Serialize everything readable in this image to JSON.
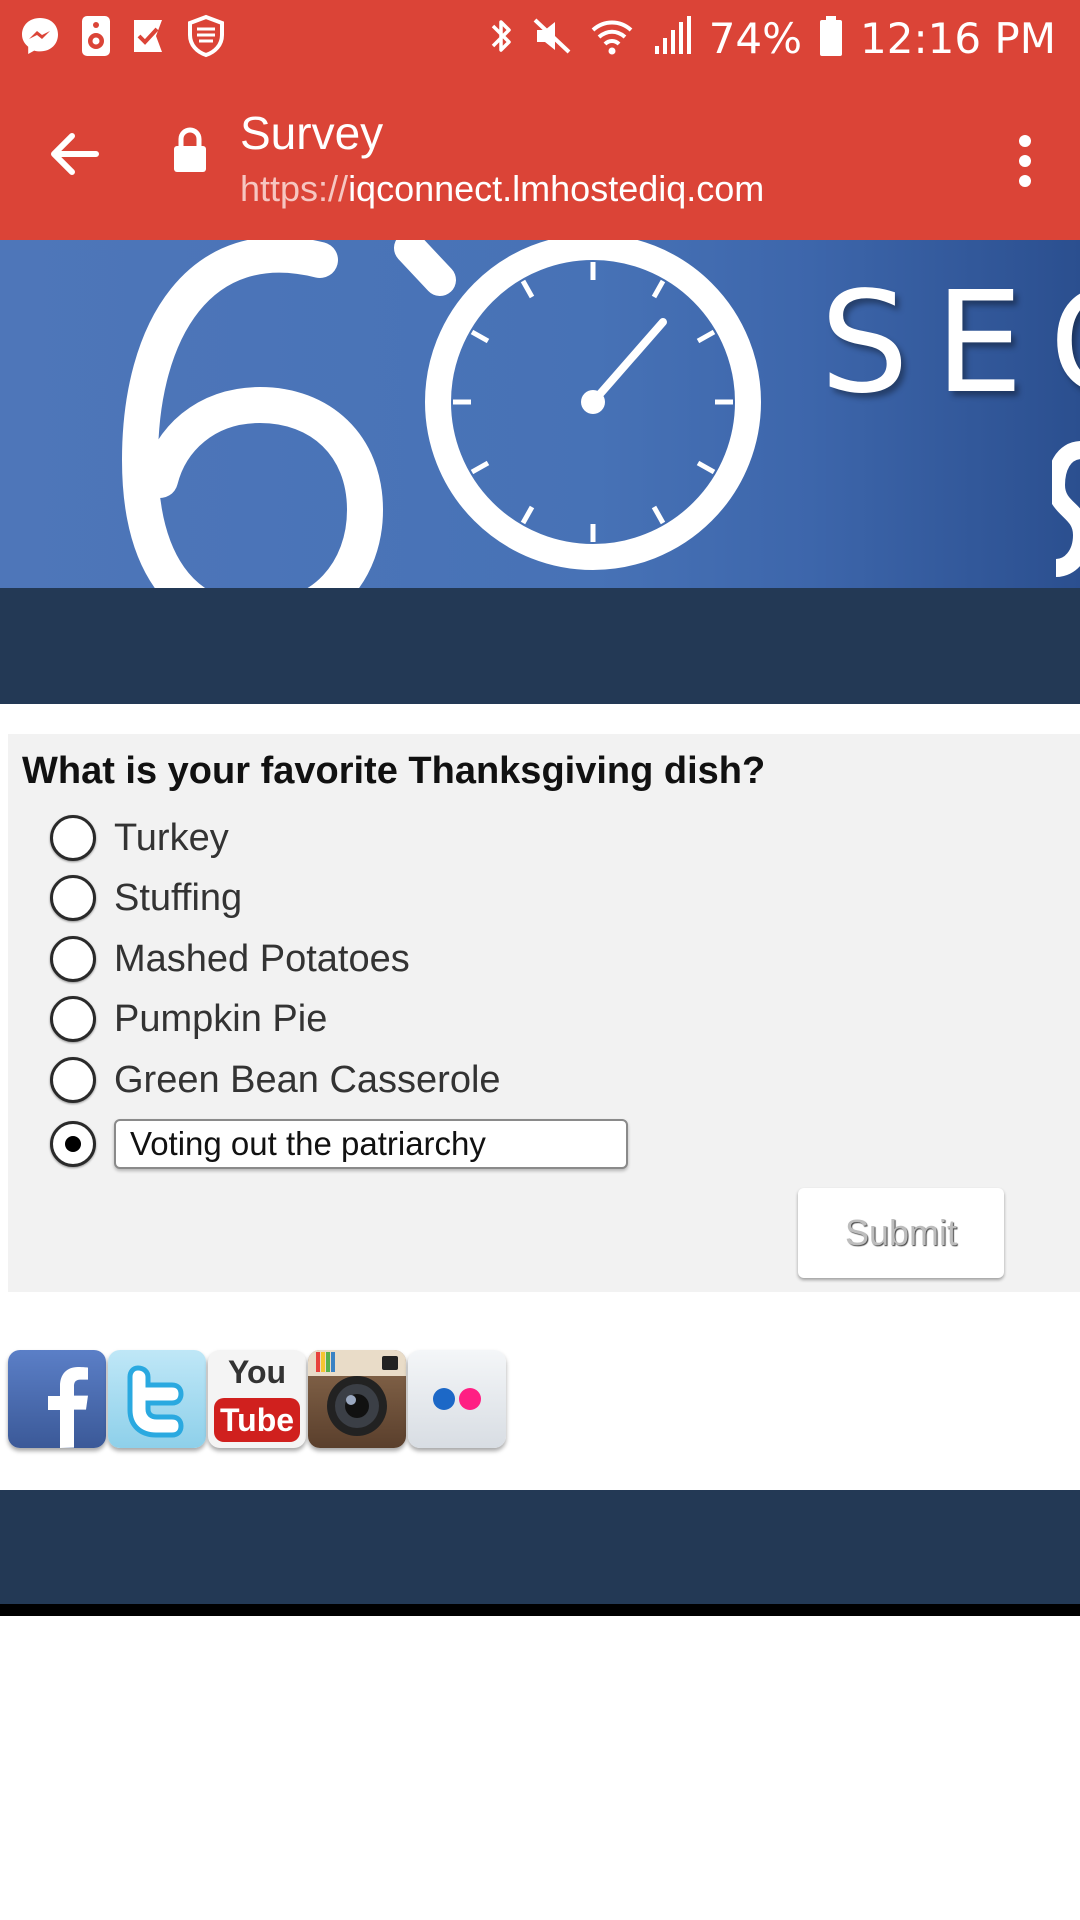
{
  "status_bar": {
    "battery": "74%",
    "time": "12:16 PM"
  },
  "app_bar": {
    "title": "Survey",
    "url_scheme": "https://",
    "url_host": "iqconnect.lmhostediq.com"
  },
  "banner": {
    "word": "SEC"
  },
  "survey": {
    "question": "What is your favorite Thanksgiving dish?",
    "options": [
      "Turkey",
      "Stuffing",
      "Mashed Potatoes",
      "Pumpkin Pie",
      "Green Bean Casserole"
    ],
    "other_value": "Voting out the patriarchy",
    "selected": "other",
    "submit_label": "Submit"
  },
  "social": {
    "youtube_top": "You",
    "youtube_bottom": "Tube",
    "icons": [
      "facebook-icon",
      "twitter-icon",
      "youtube-icon",
      "instagram-icon",
      "flickr-icon"
    ]
  },
  "colors": {
    "app_bar": "#db4437",
    "navy": "#233955",
    "banner_blue": "#4872b6"
  }
}
